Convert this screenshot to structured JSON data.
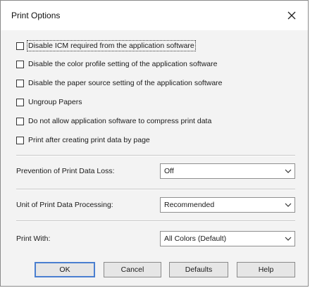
{
  "window": {
    "title": "Print Options",
    "close_icon": "close-icon"
  },
  "checkboxes": [
    {
      "label": "Disable ICM required from the application software",
      "checked": false
    },
    {
      "label": "Disable the color profile setting of the application software",
      "checked": false
    },
    {
      "label": "Disable the paper source setting of the application software",
      "checked": false
    },
    {
      "label": "Ungroup Papers",
      "checked": false
    },
    {
      "label": "Do not allow application software to compress print data",
      "checked": false
    },
    {
      "label": "Print after creating print data by page",
      "checked": false
    }
  ],
  "fields": {
    "prevention": {
      "label": "Prevention of Print Data Loss:",
      "value": "Off"
    },
    "unit": {
      "label": "Unit of Print Data Processing:",
      "value": "Recommended"
    },
    "print_with": {
      "label": "Print With:",
      "value": "All Colors (Default)"
    }
  },
  "buttons": {
    "ok": "OK",
    "cancel": "Cancel",
    "defaults": "Defaults",
    "help": "Help"
  },
  "colors": {
    "default_button_border": "#4a7fd0",
    "dialog_bg": "#f3f3f3"
  }
}
